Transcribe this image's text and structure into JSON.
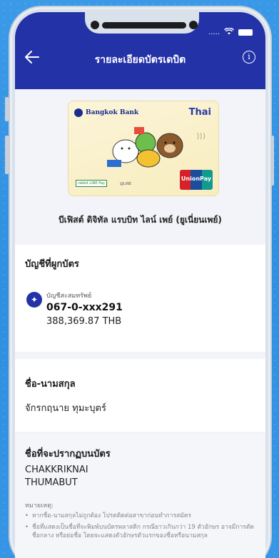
{
  "status_bar": {
    "carrier": ".....",
    "wifi_icon": "wifi-icon",
    "battery_icon": "battery-icon"
  },
  "header": {
    "title": "รายละเอียดบัตรเดบิต",
    "back_icon": "back-arrow-icon",
    "info_icon": "info-icon"
  },
  "card": {
    "bank_name": "Bangkok Bank",
    "partner": "Thai",
    "network": "UnionPay",
    "linepay_label": "rabbit LINE Pay",
    "line_label": "@LINE",
    "card_name": "บีเฟิสต์ ดิจิทัล แรบบิท ไลน์ เพย์ (ยูเนี่ยนเพย์)"
  },
  "linked_account": {
    "section_title": "บัญชีที่ผูกบัตร",
    "account_type": "บัญชีสะสมทรัพย์",
    "account_number": "067-0-xxx291",
    "balance": "388,369.87 THB"
  },
  "owner": {
    "section_title": "ชื่อ-นามสกุล",
    "full_name": "จักรกฤนาย ทุมะบุตร์"
  },
  "card_display": {
    "section_title": "ชื่อที่จะปรากฏบนบัตร",
    "first_name": "CHAKKRIKNAI",
    "last_name": "THUMABUT"
  },
  "notes": {
    "title": "หมายเหตุ:",
    "items": [
      "หากชื่อ-นามสกุลไม่ถูกต้อง โปรดติดต่อสาขาก่อนทำการสมัคร",
      "ชื่อที่แสดงเป็นชื่อที่จะพิมพ์บนบัตรพลาสติก กรณียาวเกินกว่า 19 ตัวอักษร อาจมีการตัดชื่อกลาง หรือย่อชื่อ โดยจะแสดงตัวอักษรตัวแรกของชื่อหรือนามสกุล"
    ]
  },
  "colors": {
    "header_bg": "#2432a8",
    "page_bg": "#f2f4f9",
    "outer_bg": "#3796e6"
  }
}
